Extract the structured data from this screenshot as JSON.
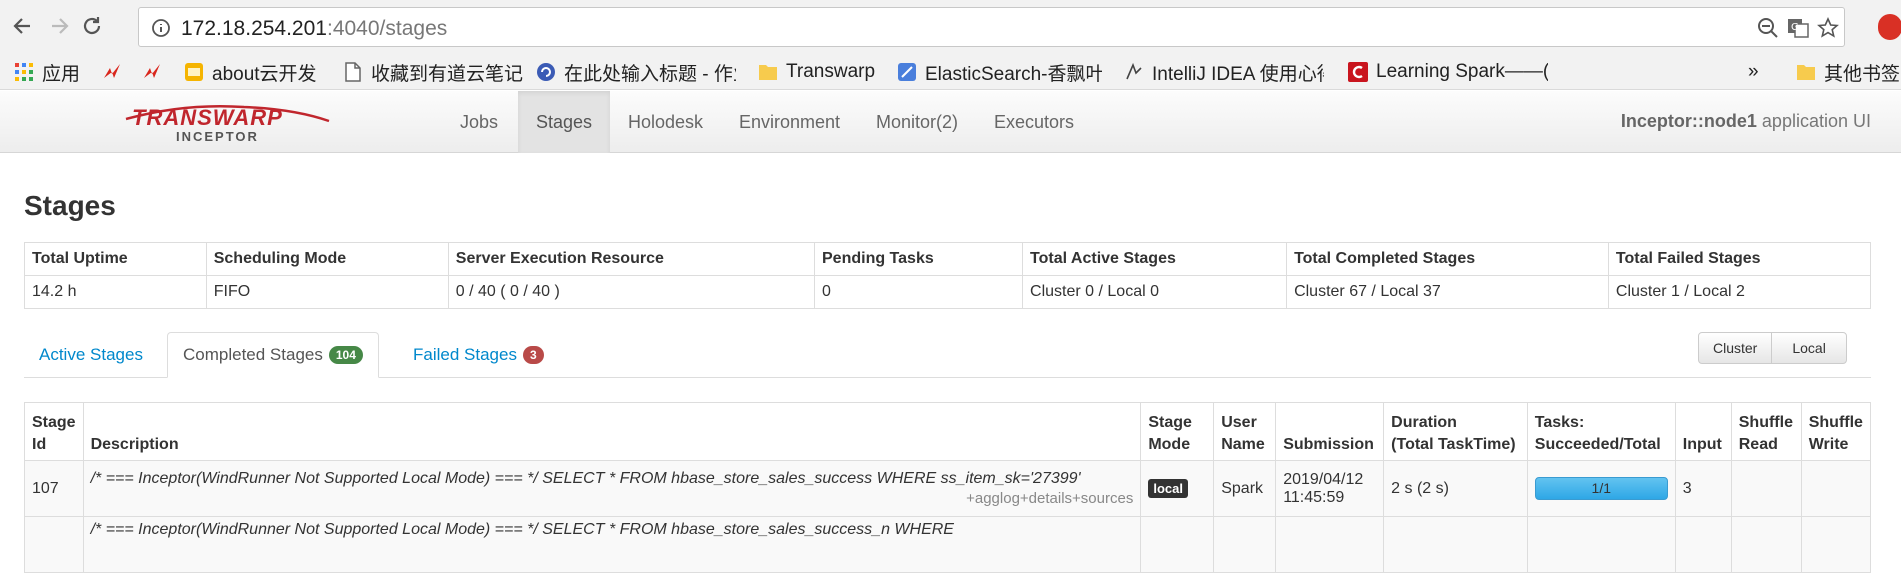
{
  "browser": {
    "url_host": "172.18.254.201",
    "url_port_path": ":4040/stages",
    "bookmarks": [
      {
        "label": "应用"
      },
      {
        "label": ""
      },
      {
        "label": ""
      },
      {
        "label": "about云开发"
      },
      {
        "label": "收藏到有道云笔记"
      },
      {
        "label": "在此处输入标题 - 作业"
      },
      {
        "label": "Transwarp"
      },
      {
        "label": "ElasticSearch-香飘叶"
      },
      {
        "label": "IntelliJ IDEA 使用心得"
      },
      {
        "label": "Learning Spark——("
      },
      {
        "label": "其他书签"
      }
    ],
    "overflow_label": "»"
  },
  "app": {
    "brand_top": "TRANSWARP",
    "brand_bottom": "INCEPTOR",
    "nav": [
      "Jobs",
      "Stages",
      "Holodesk",
      "Environment",
      "Monitor(2)",
      "Executors"
    ],
    "active_nav": "Stages",
    "title_bold": "Inceptor::node1",
    "title_rest": " application UI"
  },
  "page": {
    "heading": "Stages",
    "summary": {
      "headers": [
        "Total Uptime",
        "Scheduling Mode",
        "Server Execution Resource",
        "Pending Tasks",
        "Total Active Stages",
        "Total Completed Stages",
        "Total Failed Stages"
      ],
      "values": [
        "14.2 h",
        "FIFO",
        "0 / 40 ( 0 / 40 )",
        "0",
        "Cluster 0 / Local 0",
        "Cluster 67 / Local 37",
        "Cluster 1 / Local 2"
      ]
    },
    "tabs": {
      "active_label": "Active Stages",
      "completed_label": "Completed Stages",
      "completed_count": "104",
      "failed_label": "Failed Stages",
      "failed_count": "3"
    },
    "filter_buttons": [
      "Cluster",
      "Local"
    ],
    "table": {
      "headers": {
        "stage_id": [
          "Stage",
          "Id"
        ],
        "description": [
          "",
          "Description"
        ],
        "stage_mode": [
          "Stage",
          "Mode"
        ],
        "user_name": [
          "User",
          "Name"
        ],
        "submission": [
          "",
          "Submission"
        ],
        "duration": [
          "Duration",
          "(Total TaskTime)"
        ],
        "tasks": [
          "Tasks:",
          "Succeeded/Total"
        ],
        "input": [
          "",
          "Input"
        ],
        "shuffle_read": [
          "Shuffle",
          "Read"
        ],
        "shuffle_write": [
          "Shuffle",
          "Write"
        ]
      },
      "rows": [
        {
          "id": "107",
          "description": "/* === Inceptor(WindRunner Not Supported Local Mode) === */ SELECT * FROM hbase_store_sales_success WHERE ss_item_sk='27399'",
          "details": "+agglog+details+sources",
          "mode": "local",
          "user": "Spark",
          "submission_date": "2019/04/12",
          "submission_time": "11:45:59",
          "duration": "2 s (2 s)",
          "tasks": "1/1",
          "tasks_fraction": 1.0,
          "input": "3",
          "shuffle_read": "",
          "shuffle_write": ""
        },
        {
          "id": "",
          "description": "/* === Inceptor(WindRunner Not Supported Local Mode) === */ SELECT * FROM hbase_store_sales_success_n WHERE"
        }
      ]
    }
  }
}
